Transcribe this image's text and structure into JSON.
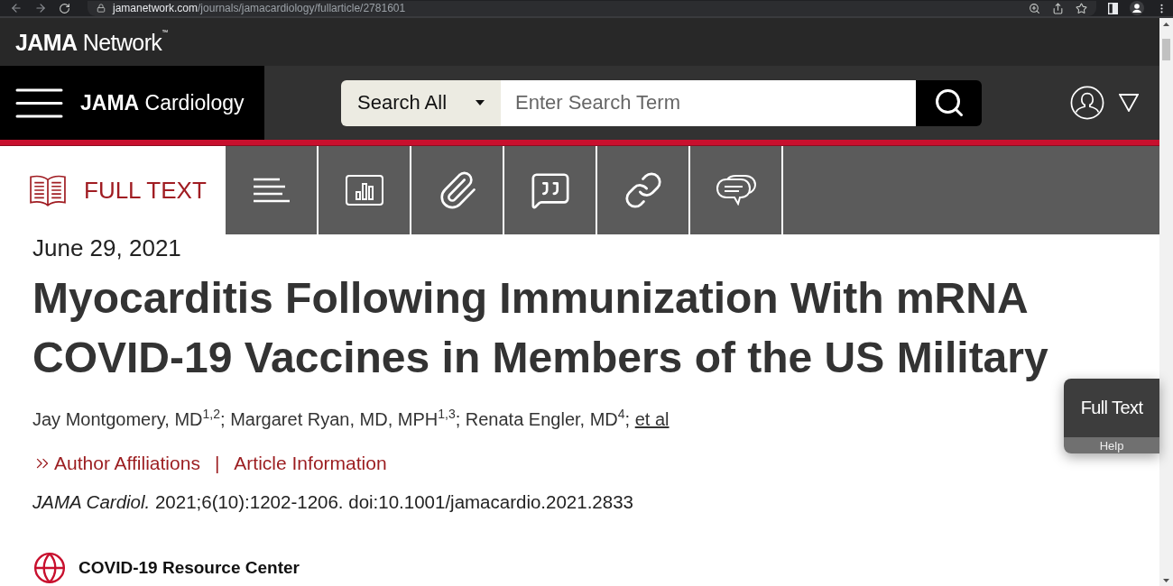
{
  "browser": {
    "url": {
      "domain": "jamanetwork.com",
      "path": "/journals/jamacardiology/fullarticle/2781601"
    }
  },
  "network_bar": {
    "logo": "**JAMA** Network$^{™}$"
  },
  "journal_bar": {
    "journal": "**JAMA** Cardiology",
    "search": {
      "scope": "Search All",
      "placeholder": "Enter Search Term"
    }
  },
  "tabs": [
    {
      "kind": "text",
      "label": "FULL TEXT",
      "selected": true
    },
    {
      "kind": "icon",
      "selected": false
    },
    {
      "kind": "icon",
      "selected": false
    },
    {
      "kind": "icon",
      "selected": false
    },
    {
      "kind": "icon",
      "selected": false
    },
    {
      "kind": "icon",
      "selected": false
    },
    {
      "kind": "icon",
      "selected": false
    }
  ],
  "article": {
    "date": "June 29, 2021",
    "title": "Myocarditis Following Immunization With mRNA COVID-19 Vaccines in Members of the US Military",
    "authors": "Jay Montgomery, MD$^{1,2}$; Margaret Ryan, MD, MPH$^{1,3}$; Renata Engler, MD$^{4}$;",
    "authors_link": "et al",
    "affiliations_link": "Author Affiliations",
    "separator": "|",
    "info_link": "Article Information",
    "citation": "*JAMA Cardiol.* 2021;6(10):1202-1206. doi:10.1001/jamacardio.2021.2833",
    "resource_center": "COVID-19 Resource Center"
  },
  "help_widget": {
    "title": "Full Text",
    "help": "Help"
  }
}
